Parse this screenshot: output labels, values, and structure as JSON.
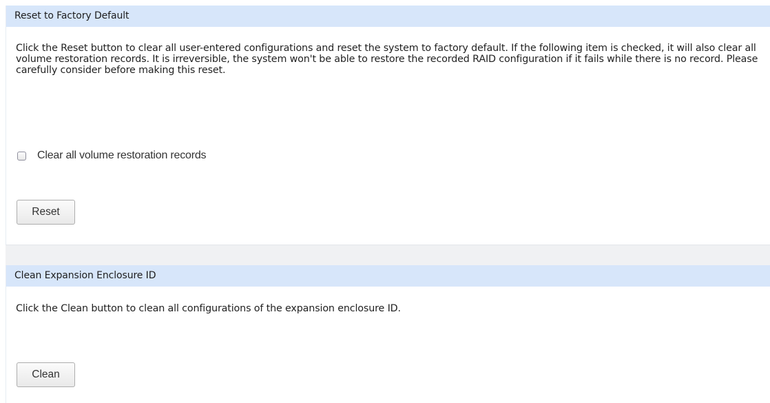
{
  "reset_section": {
    "title": "Reset to Factory Default",
    "description": "Click the Reset button to clear all user-entered configurations and reset the system to factory default. If the following item is checked, it will also clear all volume restoration records. It is irreversible, the system won't be able to restore the recorded RAID configuration if it fails while there is no record. Please carefully consider before making this reset.",
    "checkbox_label": "Clear all volume restoration records",
    "checkbox_checked": false,
    "button_label": "Reset"
  },
  "clean_section": {
    "title": "Clean Expansion Enclosure ID",
    "description": "Click the Clean button to clean all configurations of the expansion enclosure ID.",
    "button_label": "Clean"
  },
  "colors": {
    "header_bg": "#d7e6fa",
    "separator_bg": "#f0f1f3"
  }
}
